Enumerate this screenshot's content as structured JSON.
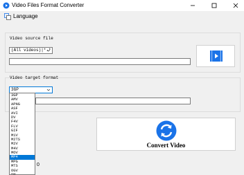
{
  "window": {
    "title": "Video Files Format Converter"
  },
  "menu": {
    "language_label": "Language"
  },
  "source": {
    "group_label": "Video source file",
    "filter_value": "(All videos)|*.*",
    "path_value": ""
  },
  "target": {
    "group_label": "Video target format",
    "format_value": "3GP",
    "path_value": "",
    "options": [
      "3GP",
      "AMV",
      "APNG",
      "ASF",
      "AVI",
      "DV",
      "F4V",
      "FLV",
      "GIF",
      "M1V",
      "M2TS",
      "M2V",
      "M4V",
      "MOV",
      "MP4",
      "MPG",
      "MTS",
      "OGV",
      "RM"
    ],
    "selected_option": "MP4"
  },
  "convert": {
    "label": "Convert Video"
  },
  "stray": {
    "status_digits": "0"
  },
  "colors": {
    "accent": "#0078d7",
    "icon_blue": "#1a73e8",
    "selection": "#0078d7"
  },
  "icons": {
    "app": "video-icon",
    "language": "language-icon",
    "video_button": "video-play-icon",
    "convert_button": "convert-arrows-icon"
  }
}
